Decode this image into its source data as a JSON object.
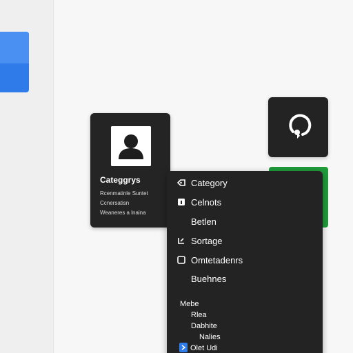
{
  "profile_card": {
    "title": "Categgrys",
    "lines": [
      "Rcenmatinle Suntet",
      "Ccnersatisn",
      "Weaneres a lnaina"
    ]
  },
  "menu": {
    "items": [
      {
        "label": "Category",
        "icon": "tag-icon"
      },
      {
        "label": "Celnots",
        "icon": "lock-icon"
      },
      {
        "label": "Betlen",
        "icon": null
      },
      {
        "label": "Sortage",
        "icon": "sort-icon"
      },
      {
        "label": "Omtetadenrs",
        "icon": "checkbox-icon"
      },
      {
        "label": "Buehnes",
        "icon": null
      }
    ],
    "section_label": "Mebe",
    "sub_items": [
      "Rlea",
      "Dabhite",
      "Nalies",
      "Olet Udi"
    ]
  },
  "colors": {
    "accent_blue": "#2f7bea",
    "accent_green": "#1f9b3a",
    "panel_dark": "#232323"
  }
}
